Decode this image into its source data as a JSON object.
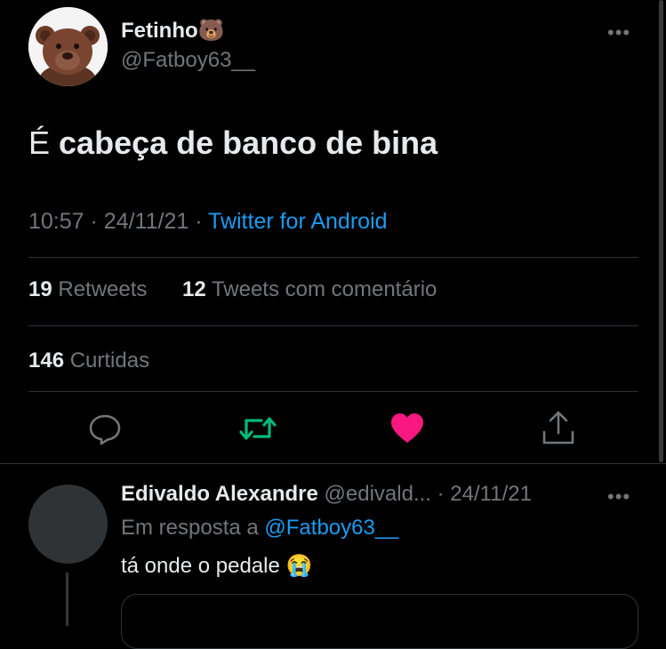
{
  "tweet": {
    "author_name": "Fetinho",
    "author_emoji": "🐻",
    "author_handle": "@Fatboy63__",
    "text_prefix": "É",
    "text_bold": "cabeça de banco de bina",
    "time": "10:57",
    "date": "24/11/21",
    "source": "Twitter for Android",
    "retweets_count": "19",
    "retweets_label": "Retweets",
    "quotes_count": "12",
    "quotes_label": "Tweets com comentário",
    "likes_count": "146",
    "likes_label": "Curtidas",
    "more_label": "•••"
  },
  "reply": {
    "author_name": "Edivaldo Alexandre",
    "author_handle": "@edivald...",
    "date": "24/11/21",
    "reply_to_label": "Em resposta a",
    "reply_to_handle": "@Fatboy63__",
    "text": "tá onde o pedale",
    "emoji": "😭",
    "more_label": "•••"
  },
  "icons": {
    "reply": "reply-icon",
    "retweet": "retweet-icon",
    "like": "heart-icon",
    "share": "share-icon"
  },
  "colors": {
    "background": "#000000",
    "text": "#e7e9ea",
    "secondary": "#71767b",
    "link": "#1d9bf0",
    "retweet_active": "#00ba7c",
    "like_active": "#f91880",
    "divider": "#2f3336"
  }
}
